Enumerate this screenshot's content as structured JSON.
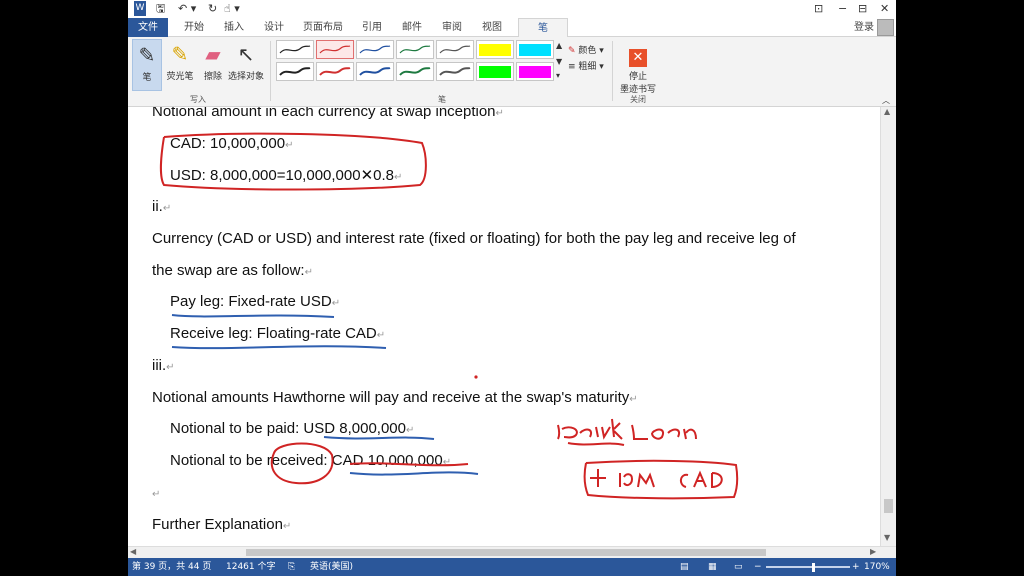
{
  "titlebar": {
    "undo": "↶ ▾",
    "redo": "↻",
    "touch": "☝ ▾",
    "restore": "⊡",
    "minimize": "−",
    "maximize": "⊟",
    "close": "✕"
  },
  "tabs": {
    "file": "文件",
    "home": "开始",
    "insert": "插入",
    "design": "设计",
    "layout": "页面布局",
    "references": "引用",
    "mailings": "邮件",
    "review": "审阅",
    "view": "视图",
    "pens": "笔",
    "login": "登录"
  },
  "ribbon": {
    "pen": "笔",
    "highlighter": "荧光笔",
    "eraser": "擦除",
    "select_objects": "选择对象",
    "group_write": "写入",
    "group_pens": "笔",
    "color": "颜色 ▾",
    "thickness": "粗细 ▾",
    "stop_ink_line1": "停止",
    "stop_ink_line2": "墨迹书写",
    "group_close": "关闭",
    "pen_colors": [
      "#222222",
      "#d03030",
      "#2050a0",
      "#1e7a40",
      "#555555",
      "#ffff00",
      "#00e0ff",
      "#222222",
      "#d03030",
      "#2050a0",
      "#1e7a40",
      "#555555",
      "#00ff00",
      "#ff00ff"
    ]
  },
  "document": {
    "l1": "Notional amount in each currency at swap inception",
    "l2": "CAD: 10,000,000",
    "l3": "USD: 8,000,000=10,000,000✕0.8",
    "l4": "ii.",
    "l5": "Currency (CAD or USD) and interest rate (fixed or floating) for both the pay leg and receive leg of",
    "l6": "the swap are as follow:",
    "l7": "Pay leg: Fixed-rate USD",
    "l8": "Receive leg: Floating-rate CAD",
    "l9": "iii.",
    "l10": "Notional amounts Hawthorne will pay and receive at the swap's maturity",
    "l11": "Notional to be paid: USD 8,000,000",
    "l12": "Notional to be received: CAD 10,000,000",
    "l14": "Further Explanation",
    "para_mark": "↵"
  },
  "status": {
    "page": "第 39 页，共 44 页",
    "words": "12461 个字",
    "lang": "英语(美国)",
    "zoom": "170%"
  }
}
